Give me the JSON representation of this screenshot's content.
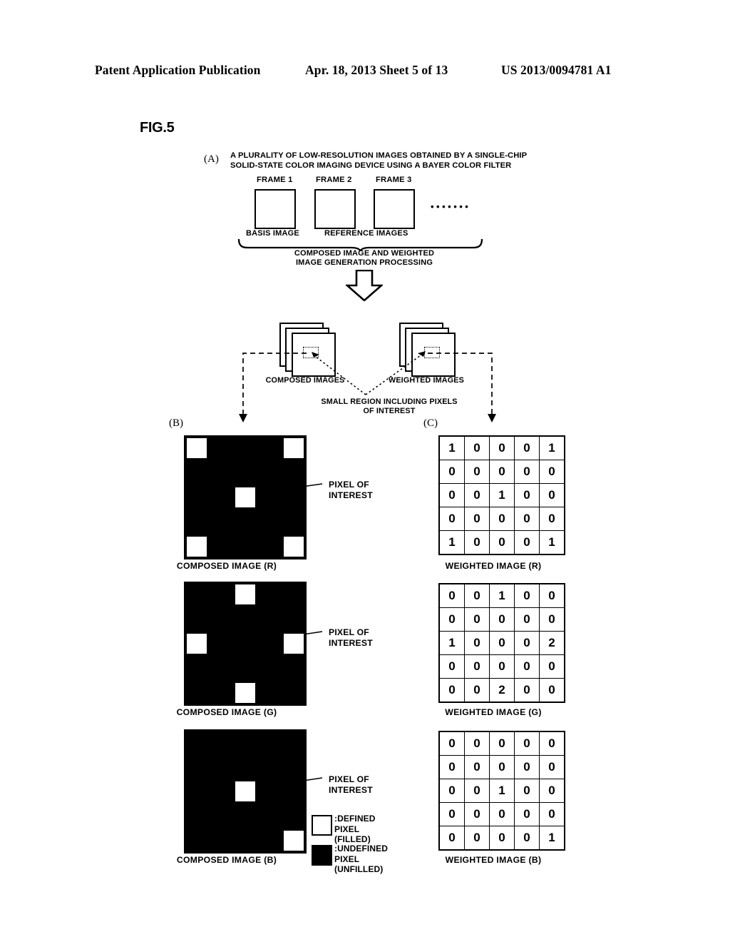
{
  "header": {
    "publication": "Patent Application Publication",
    "date_sheet": "Apr. 18, 2013  Sheet 5 of 13",
    "pub_number": "US 2013/0094781 A1"
  },
  "figure": {
    "title": "FIG.5",
    "section_a_letter": "(A)",
    "section_b_letter": "(B)",
    "section_c_letter": "(C)",
    "a_caption": "A PLURALITY OF LOW-RESOLUTION IMAGES OBTAINED BY A SINGLE-CHIP SOLID-STATE COLOR IMAGING DEVICE USING A BAYER COLOR FILTER",
    "frames": [
      {
        "label": "FRAME 1"
      },
      {
        "label": "FRAME 2"
      },
      {
        "label": "FRAME 3"
      }
    ],
    "ellipsis": "•••••••",
    "basis_image_label": "BASIS IMAGE",
    "reference_images_label": "REFERENCE IMAGES",
    "processing_label": "COMPOSED IMAGE AND WEIGHTED IMAGE GENERATION PROCESSING",
    "composed_images_label": "COMPOSED IMAGES",
    "weighted_images_label": "WEIGHTED IMAGES",
    "small_region_label": "SMALL REGION INCLUDING PIXELS OF INTEREST",
    "pixel_of_interest_label": "PIXEL OF INTEREST"
  },
  "composed_images": [
    {
      "caption": "COMPOSED IMAGE (R)",
      "channel": "R",
      "grid": [
        [
          1,
          0,
          0,
          0,
          1
        ],
        [
          0,
          0,
          0,
          0,
          0
        ],
        [
          0,
          0,
          1,
          0,
          0
        ],
        [
          0,
          0,
          0,
          0,
          0
        ],
        [
          1,
          0,
          0,
          0,
          1
        ]
      ]
    },
    {
      "caption": "COMPOSED IMAGE (G)",
      "channel": "G",
      "grid": [
        [
          0,
          0,
          1,
          0,
          0
        ],
        [
          0,
          0,
          0,
          0,
          0
        ],
        [
          1,
          0,
          0,
          0,
          1
        ],
        [
          0,
          0,
          0,
          0,
          0
        ],
        [
          0,
          0,
          1,
          0,
          0
        ]
      ]
    },
    {
      "caption": "COMPOSED IMAGE (B)",
      "channel": "B",
      "grid": [
        [
          0,
          0,
          0,
          0,
          0
        ],
        [
          0,
          0,
          0,
          0,
          0
        ],
        [
          0,
          0,
          1,
          0,
          0
        ],
        [
          0,
          0,
          0,
          0,
          0
        ],
        [
          0,
          0,
          0,
          0,
          1
        ]
      ]
    }
  ],
  "weighted_images": [
    {
      "caption": "WEIGHTED IMAGE (R)",
      "channel": "R",
      "values": [
        [
          "1",
          "0",
          "0",
          "0",
          "1"
        ],
        [
          "0",
          "0",
          "0",
          "0",
          "0"
        ],
        [
          "0",
          "0",
          "1",
          "0",
          "0"
        ],
        [
          "0",
          "0",
          "0",
          "0",
          "0"
        ],
        [
          "1",
          "0",
          "0",
          "0",
          "1"
        ]
      ]
    },
    {
      "caption": "WEIGHTED IMAGE (G)",
      "channel": "G",
      "values": [
        [
          "0",
          "0",
          "1",
          "0",
          "0"
        ],
        [
          "0",
          "0",
          "0",
          "0",
          "0"
        ],
        [
          "1",
          "0",
          "0",
          "0",
          "2"
        ],
        [
          "0",
          "0",
          "0",
          "0",
          "0"
        ],
        [
          "0",
          "0",
          "2",
          "0",
          "0"
        ]
      ]
    },
    {
      "caption": "WEIGHTED IMAGE (B)",
      "channel": "B",
      "values": [
        [
          "0",
          "0",
          "0",
          "0",
          "0"
        ],
        [
          "0",
          "0",
          "0",
          "0",
          "0"
        ],
        [
          "0",
          "0",
          "1",
          "0",
          "0"
        ],
        [
          "0",
          "0",
          "0",
          "0",
          "0"
        ],
        [
          "0",
          "0",
          "0",
          "0",
          "1"
        ]
      ]
    }
  ],
  "legend": [
    {
      "swatch": "white",
      "text": ":DEFINED PIXEL\n(FILLED)"
    },
    {
      "swatch": "black",
      "text": ":UNDEFINED PIXEL\n(UNFILLED)"
    }
  ],
  "colors": {
    "ink": "#000000",
    "paper": "#ffffff"
  }
}
